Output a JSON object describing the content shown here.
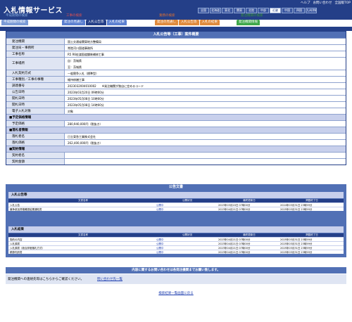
{
  "app_title": "入札情報サービス",
  "top_links": [
    "ヘルプ",
    "お問い合わせ",
    "全国版TOP"
  ],
  "regions": [
    {
      "label": "全国",
      "active": false
    },
    {
      "label": "北海道",
      "active": false
    },
    {
      "label": "東北",
      "active": false
    },
    {
      "label": "関東",
      "active": false
    },
    {
      "label": "北陸",
      "active": false
    },
    {
      "label": "中部",
      "active": false
    },
    {
      "label": "近畿",
      "active": true
    },
    {
      "label": "中国",
      "active": false
    },
    {
      "label": "四国",
      "active": false
    },
    {
      "label": "九州沖縄",
      "active": false
    }
  ],
  "nav": {
    "groups": [
      {
        "title": "平成期間の検索",
        "title_color": "#8ab0e0",
        "tab_color": "#7b9bd6",
        "tabs": [
          {
            "label": "平成期間の検索",
            "active": false
          }
        ]
      },
      {
        "title": "工事の検索",
        "title_color": "#e05050",
        "tab_color": "#5b7fd0",
        "tabs": [
          {
            "label": "発注の見通し",
            "active": false
          },
          {
            "label": "入札公告等",
            "active": true
          },
          {
            "label": "入札の結果",
            "active": false
          }
        ]
      },
      {
        "title": "業務の検索",
        "title_color": "#e07030",
        "tab_color": "#e08a3c",
        "tabs": [
          {
            "label": "発注の見通し",
            "active": false
          },
          {
            "label": "入札公告等",
            "active": false
          },
          {
            "label": "入札の結果",
            "active": false
          }
        ]
      },
      {
        "title": "発注機関の検索",
        "title_color": "#3a9a3a",
        "tab_color": "#3fa74a",
        "tabs": [
          {
            "label": "発注機関情報",
            "active": false
          }
        ]
      }
    ]
  },
  "detail": {
    "title": "入札公告等（工事）案件概要",
    "rows": [
      {
        "label": "発注機関",
        "values": [
          "国土交通省関東地方整備局"
        ]
      },
      {
        "label": "発注局・事務所",
        "values": [
          "常陸河川国道事務所"
        ]
      },
      {
        "label": "工事名称",
        "values": [
          "R5 R6佐渡国道舗装補修工事"
        ]
      },
      {
        "label": "工事場所",
        "values": [
          "自：茨城県",
          "至：茨城県"
        ]
      },
      {
        "label": "入札契約方式",
        "values": [
          "一般競争入札（標準型）"
        ]
      },
      {
        "label": "工事種別／工事の事種",
        "values": [
          "維持修繕工事"
        ]
      },
      {
        "label": "調達番号",
        "values": [
          "2023032004010002　　※発注機関が独自に定めるコード"
        ]
      },
      {
        "label": "公告日時",
        "values": [
          "2023年03月20日 09時00分"
        ]
      },
      {
        "label": "開札日時",
        "values": [
          "2023年05月08日 10時00分"
        ]
      },
      {
        "label": "開札日時",
        "values": [
          "2023年05月08日 14時00分"
        ]
      },
      {
        "label": "電子入札対象",
        "values": [
          "対象"
        ]
      }
    ],
    "sections": [
      {
        "title": "■予定価格情報",
        "rows": [
          {
            "label": "予定価格",
            "values": [
              "280,940,000円（税抜き）"
            ]
          }
        ]
      },
      {
        "title": "■落札者情報",
        "rows": [
          {
            "label": "落札者名",
            "values": [
              "日立東急工業株式会社"
            ]
          },
          {
            "label": "落札価格",
            "values": [
              "262,400,000円（税抜き）"
            ]
          }
        ]
      },
      {
        "title": "■契約情報",
        "rows": [
          {
            "label": "契約者名",
            "values": [
              ""
            ]
          },
          {
            "label": "契約金額",
            "values": [
              ""
            ]
          }
        ]
      }
    ]
  },
  "documents": {
    "title": "公告文書",
    "columns": [
      "文書名称",
      "公開状況",
      "最終更新日",
      "掲載終了日"
    ],
    "sections": [
      {
        "title": "入札公告等",
        "rows": [
          [
            "入札公告",
            "公開中",
            "2023年03月20日 07時00分",
            "2024年03月31日 23時59分"
          ],
          [
            "競争参加資格確認結果通知書",
            "公開中",
            "2023年04月21日 07時00分",
            "2025年03月31日 23時59分"
          ]
        ]
      },
      {
        "title": "入札結果",
        "rows": [
          [
            "契約の内容",
            "公開中",
            "2023年04月21日 07時00分",
            "2025年03月31日 23時59分"
          ],
          [
            "入札調書",
            "公開中",
            "2023年04月21日 07時00分",
            "2025年03月31日 23時59分"
          ],
          [
            "入札調書（総合評価落札方式）",
            "公開中",
            "2023年04月21日 07時00分",
            "2025年03月31日 23時59分"
          ],
          [
            "積算内訳書",
            "公開中",
            "2023年04月21日 07時00分",
            "2025年03月31日 23時59分"
          ]
        ]
      }
    ]
  },
  "contact": {
    "header": "内容に関するお問い合わせは各発注機関までお願い致します。",
    "note": "発注機関への連絡先等はこちらからご確認ください。",
    "link": "問い合わせ先一覧"
  },
  "back_link": "検索結果一覧画面に戻る"
}
